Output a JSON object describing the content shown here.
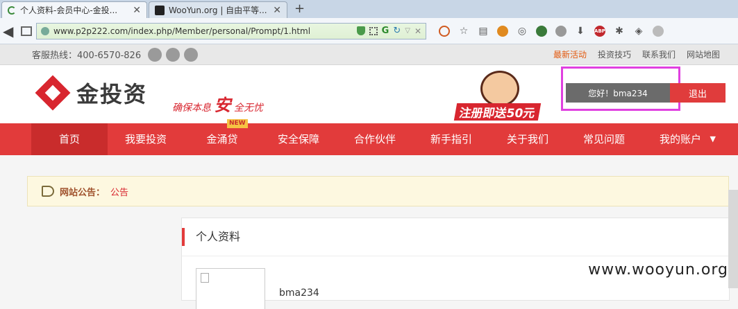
{
  "browser": {
    "tabs": [
      {
        "title": "个人资料-会员中心-金投...",
        "active": true
      },
      {
        "title": "WooYun.org | 自由平等...",
        "active": false
      }
    ],
    "new_tab": "+",
    "url": "www.p2p222.com/index.php/Member/personal/Prompt/1.html",
    "toolbar_icons": [
      "block-icon",
      "star-icon",
      "reader-icon",
      "fox-icon",
      "palette-icon",
      "green-ball-icon",
      "world-icon",
      "download-icon",
      "abp-icon",
      "bug-icon",
      "layers-icon",
      "more-icon"
    ]
  },
  "site": {
    "hotline": "客服热线：400-6570-826",
    "top_links": [
      "最新活动",
      "投资技巧",
      "联系我们",
      "网站地图"
    ],
    "logo_text": "金投资",
    "slogan_a": "确保本息",
    "slogan_big": "安",
    "slogan_b": "全无忧",
    "promo_text": "注册即送50元",
    "greeting": "您好！bma234",
    "logout": "退出",
    "nav": [
      "首页",
      "我要投资",
      "金涌贷",
      "安全保障",
      "合作伙伴",
      "新手指引",
      "关于我们",
      "常见问题",
      "我的账户"
    ],
    "new_badge": "NEW",
    "notice_label": "网站公告：",
    "notice_text": "公告",
    "panel_title": "个人资料",
    "username": "bma234",
    "watermark": "www.wooyun.org",
    "accent_color": "#e23b3b"
  }
}
